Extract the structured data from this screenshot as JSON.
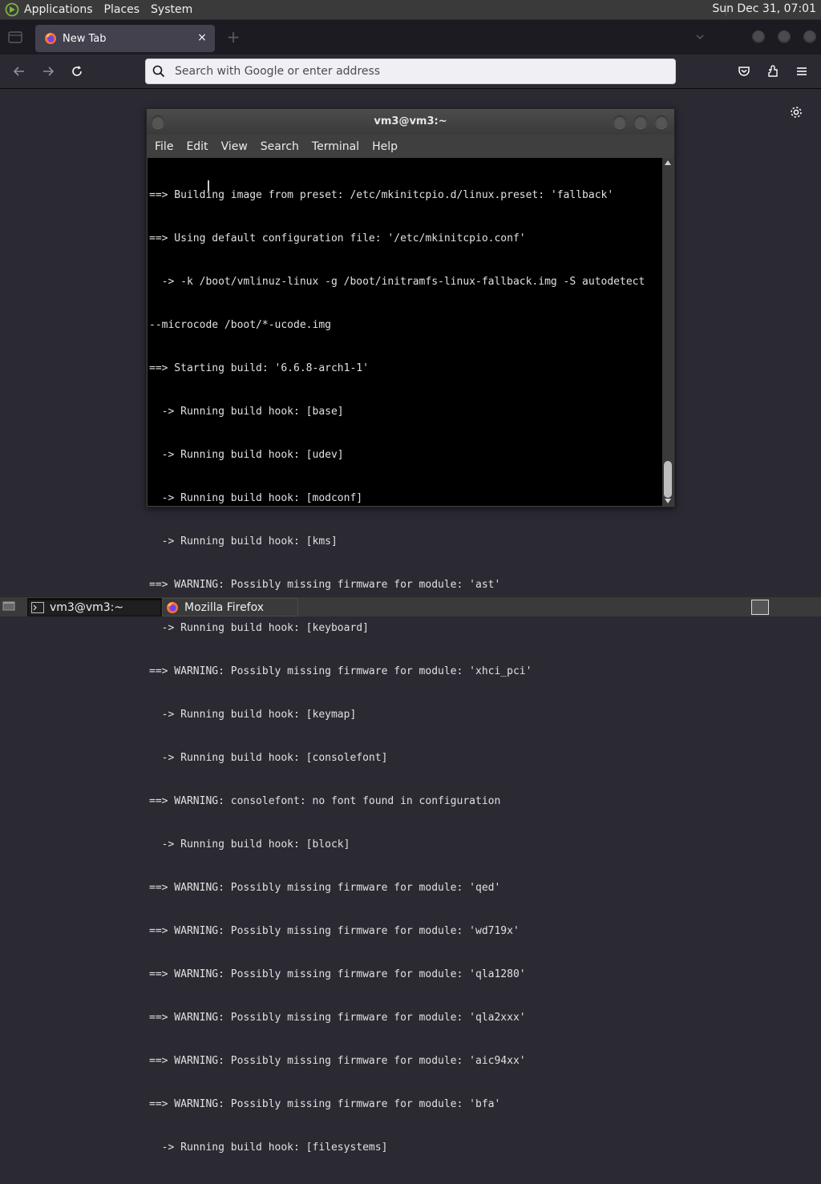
{
  "top_panel": {
    "menu": [
      "Applications",
      "Places",
      "System"
    ],
    "clock": "Sun Dec 31, 07:01"
  },
  "browser": {
    "tab": {
      "title": "New Tab",
      "close": "×"
    },
    "new_tab": "+",
    "url": {
      "placeholder": "Search with Google or enter address",
      "value": ""
    }
  },
  "terminal": {
    "title": "vm3@vm3:~",
    "menu": [
      "File",
      "Edit",
      "View",
      "Search",
      "Terminal",
      "Help"
    ],
    "lines": [
      "==> Building image from preset: /etc/mkinitcpio.d/linux.preset: 'fallback'",
      "==> Using default configuration file: '/etc/mkinitcpio.conf'",
      "  -> -k /boot/vmlinuz-linux -g /boot/initramfs-linux-fallback.img -S autodetect",
      "--microcode /boot/*-ucode.img",
      "==> Starting build: '6.6.8-arch1-1'",
      "  -> Running build hook: [base]",
      "  -> Running build hook: [udev]",
      "  -> Running build hook: [modconf]",
      "  -> Running build hook: [kms]",
      "==> WARNING: Possibly missing firmware for module: 'ast'",
      "  -> Running build hook: [keyboard]",
      "==> WARNING: Possibly missing firmware for module: 'xhci_pci'",
      "  -> Running build hook: [keymap]",
      "  -> Running build hook: [consolefont]",
      "==> WARNING: consolefont: no font found in configuration",
      "  -> Running build hook: [block]",
      "==> WARNING: Possibly missing firmware for module: 'qed'",
      "==> WARNING: Possibly missing firmware for module: 'wd719x'",
      "==> WARNING: Possibly missing firmware for module: 'qla1280'",
      "==> WARNING: Possibly missing firmware for module: 'qla2xxx'",
      "==> WARNING: Possibly missing firmware for module: 'aic94xx'",
      "==> WARNING: Possibly missing firmware for module: 'bfa'",
      "  -> Running build hook: [filesystems]"
    ]
  },
  "taskbar": {
    "tasks": [
      {
        "label": "vm3@vm3:~",
        "icon": "terminal-icon",
        "active": true
      },
      {
        "label": "Mozilla Firefox",
        "icon": "firefox-icon",
        "active": false
      }
    ]
  },
  "colors": {
    "browser_bg": "#2b2a33",
    "terminal_bg": "#000000",
    "panel_bg": "#3a3a3a"
  }
}
